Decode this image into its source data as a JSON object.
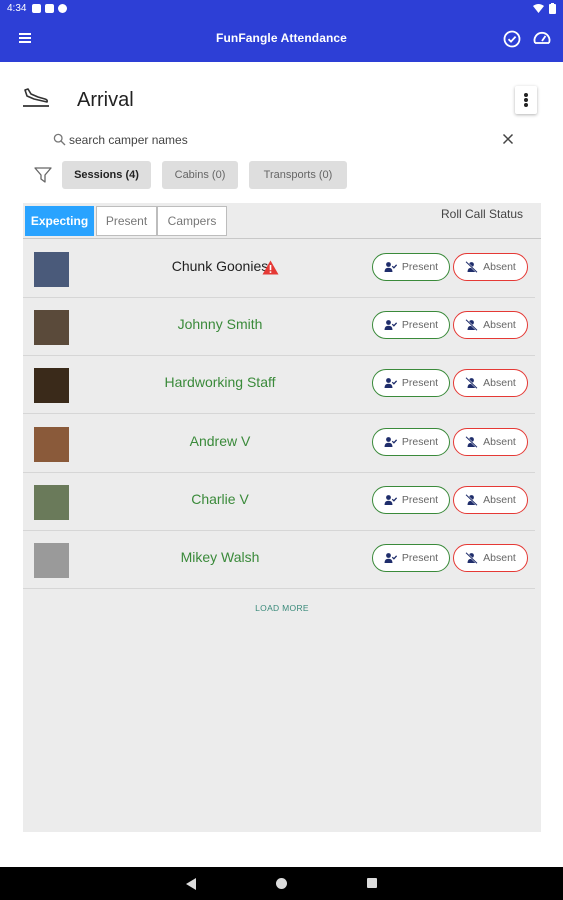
{
  "status_bar": {
    "time": "4:34"
  },
  "app_bar": {
    "title": "FunFangle Attendance"
  },
  "page": {
    "title": "Arrival"
  },
  "search": {
    "placeholder": "search camper names",
    "value": ""
  },
  "filters": {
    "chips": [
      {
        "label": "Sessions (4)",
        "active": true
      },
      {
        "label": "Cabins (0)",
        "active": false
      },
      {
        "label": "Transports (0)",
        "active": false
      }
    ]
  },
  "tabs": [
    {
      "label": "Expecting",
      "active": true
    },
    {
      "label": "Present",
      "active": false
    },
    {
      "label": "Campers",
      "active": false
    }
  ],
  "roll_call_label": "Roll Call Status",
  "campers": [
    {
      "name": "Chunk Goonies",
      "warning": true,
      "photo_color": "#4a5a7a"
    },
    {
      "name": "Johnny Smith",
      "warning": false,
      "photo_color": "#5a4a3a"
    },
    {
      "name": "Hardworking Staff",
      "warning": false,
      "photo_color": "#3a2a1a"
    },
    {
      "name": "Andrew V",
      "warning": false,
      "photo_color": "#8a5a3a"
    },
    {
      "name": "Charlie V",
      "warning": false,
      "photo_color": "#6a7a5a"
    },
    {
      "name": "Mikey Walsh",
      "warning": false,
      "photo_color": "#9a9a9a"
    }
  ],
  "buttons": {
    "present": "Present",
    "absent": "Absent"
  },
  "load_more": "LOAD MORE",
  "colors": {
    "primary": "#2d3fd6",
    "tab_active": "#29a3ff",
    "present": "#3a8a3a",
    "absent": "#e53935",
    "warning": "#e53935"
  }
}
